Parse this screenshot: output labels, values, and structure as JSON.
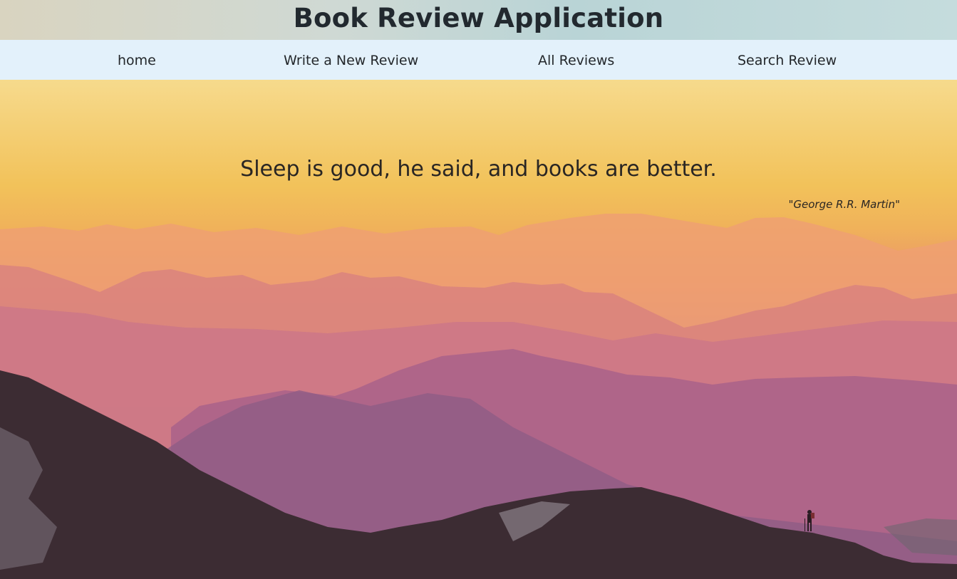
{
  "header": {
    "title": "Book Review Application"
  },
  "nav": {
    "items": [
      {
        "label": "home"
      },
      {
        "label": "Write a New Review"
      },
      {
        "label": "All Reviews"
      },
      {
        "label": "Search Review"
      }
    ]
  },
  "hero": {
    "quote": "Sleep is good, he said, and books are better.",
    "author": "\"George R.R. Martin\"",
    "background_icon": "mountain-landscape",
    "colors": {
      "sky_top": "#f3e3a3",
      "sun_glow": "#f2c25a",
      "mid_haze": "#cf7a86",
      "deep_purple": "#9d6590",
      "foreground": "#3b2a30",
      "navbar_bg": "#e3f1fb",
      "text": "#22292f"
    }
  }
}
